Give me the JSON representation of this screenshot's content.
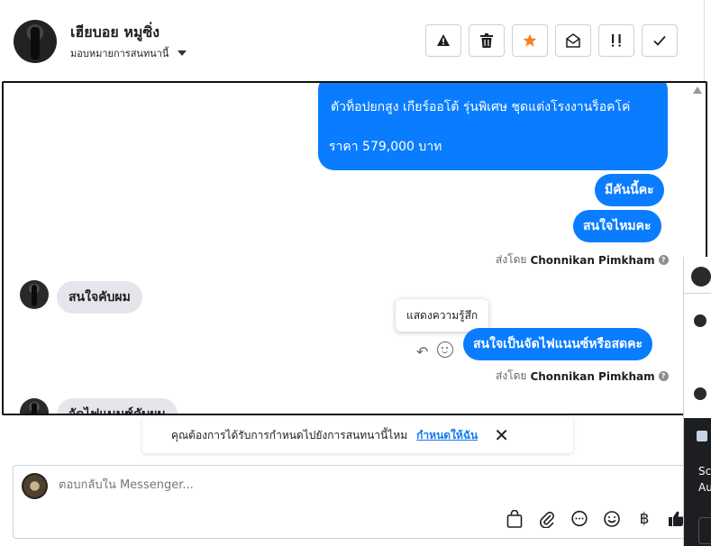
{
  "header": {
    "contact_name": "เฮียบอย หมูซิ่ง",
    "assign_label": "มอบหมายการสนทนานี้"
  },
  "actions": [
    {
      "name": "report-button",
      "icon": "warning-icon"
    },
    {
      "name": "delete-button",
      "icon": "trash-icon"
    },
    {
      "name": "star-button",
      "icon": "star-icon",
      "color": "#f5821f"
    },
    {
      "name": "mark-unread-button",
      "icon": "envelope-open-icon"
    },
    {
      "name": "follow-up-button",
      "icon": "important-icon"
    },
    {
      "name": "done-button",
      "icon": "check-icon"
    }
  ],
  "messages": {
    "big_bubble_line1": "ตัวท็อปยกสูง เกียร์ออโต้ รุ่นพิเศษ ชุดแต่งโรงงานร็อคโค่",
    "big_bubble_line2": "ราคา 579,000 บาท",
    "out1": "มีคันนี้คะ",
    "out2": "สนใจไหมคะ",
    "sent_by_prefix": "ส่งโดย",
    "sender_name": "Chonnikan Pimkham",
    "in1": "สนใจคับผม",
    "tooltip": "แสดงความรู้สึก",
    "out3": "สนใจเป็นจัดไฟแนนซ์หรือสดคะ",
    "in2": "จัดไฟแนนซ์คับผม"
  },
  "banner": {
    "text": "คุณต้องการได้รับการกำหนดไปยังการสนทนานี้ไหม",
    "link": "กำหนดให้ฉัน"
  },
  "composer": {
    "placeholder": "ตอบกลับใน Messenger..."
  },
  "side_panel": {
    "text1": "Sc",
    "text2": "Au"
  },
  "colors": {
    "outgoing_bubble": "#0a7cff",
    "incoming_bubble": "#e4e6eb",
    "link": "#1877f2",
    "star": "#f5821f"
  }
}
